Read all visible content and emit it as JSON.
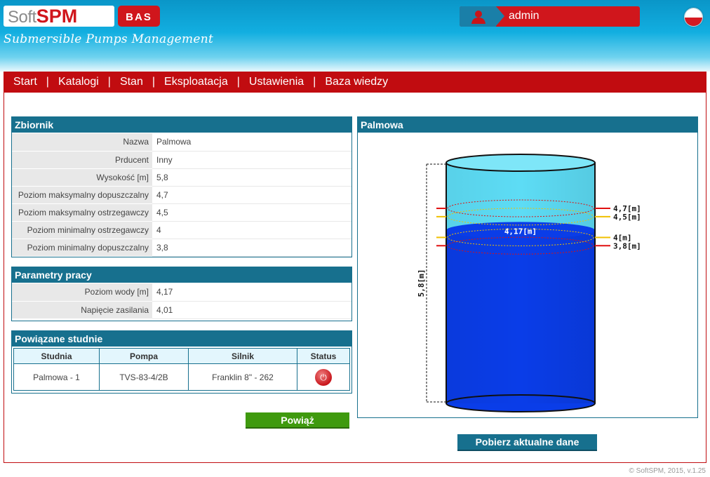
{
  "header": {
    "logo_soft": "Soft",
    "logo_spm": "SPM",
    "logo_bas": "BAS",
    "subtitle": "Submersible Pumps Management",
    "username": "admin",
    "language_flag": "pl-flag-icon"
  },
  "nav": {
    "items": [
      "Start",
      "Katalogi",
      "Stan",
      "Eksploatacja",
      "Ustawienia",
      "Baza wiedzy"
    ],
    "separator": "|"
  },
  "reservoir": {
    "title": "Zbiornik",
    "rows": [
      {
        "label": "Nazwa",
        "value": "Palmowa"
      },
      {
        "label": "Prducent",
        "value": "Inny"
      },
      {
        "label": "Wysokość [m]",
        "value": "5,8"
      },
      {
        "label": "Poziom maksymalny dopuszczalny",
        "value": "4,7"
      },
      {
        "label": "Poziom maksymalny ostrzegawczy",
        "value": "4,5"
      },
      {
        "label": "Poziom minimalny ostrzegawczy",
        "value": "4"
      },
      {
        "label": "Poziom minimalny dopuszczalny",
        "value": "3,8"
      }
    ]
  },
  "params": {
    "title": "Parametry pracy",
    "rows": [
      {
        "label": "Poziom wody [m]",
        "value": "4,17"
      },
      {
        "label": "Napięcie zasilania",
        "value": "4,01"
      }
    ]
  },
  "wells": {
    "title": "Powiązane studnie",
    "headers": [
      "Studnia",
      "Pompa",
      "Silnik",
      "Status"
    ],
    "rows": [
      {
        "studnia": "Palmowa - 1",
        "pompa": "TVS-83-4/2B",
        "silnik": "Franklin 8\" - 262",
        "status_icon": "power-icon"
      }
    ]
  },
  "tank": {
    "title": "Palmowa",
    "height_label": "5,8[m]",
    "current_label": "4,17[m]",
    "height_m": 5.8,
    "current_m": 4.17,
    "levels": [
      {
        "label": "4,7[m]",
        "value": 4.7,
        "kind": "max-allowed"
      },
      {
        "label": "4,5[m]",
        "value": 4.5,
        "kind": "max-warning"
      },
      {
        "label": "4[m]",
        "value": 4.0,
        "kind": "min-warning"
      },
      {
        "label": "3,8[m]",
        "value": 3.8,
        "kind": "min-allowed"
      }
    ],
    "colors": {
      "water": "#0a3de8",
      "empty": "#5ddcf5",
      "alarm": "#e01010",
      "warning": "#f0c000"
    }
  },
  "actions": {
    "link_label": "Powiąż",
    "fetch_label": "Pobierz aktualne dane"
  },
  "footer": {
    "copyright": "© SoftSPM, 2015, v.1.25"
  }
}
